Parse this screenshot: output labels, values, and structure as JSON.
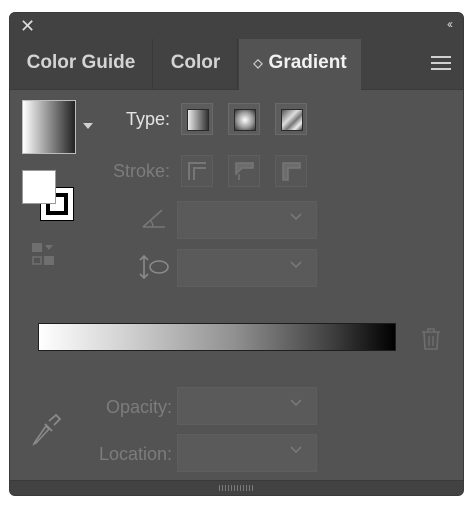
{
  "titlebar": {
    "close_icon": "close-icon",
    "collapse_icon": "double-chevron-left-icon",
    "close_glyph": "✕",
    "collapse_glyph": "‹‹"
  },
  "tabs": [
    {
      "label": "Color Guide",
      "active": false
    },
    {
      "label": "Color",
      "active": false
    },
    {
      "label": "Gradient",
      "active": true
    }
  ],
  "labels": {
    "type": "Type:",
    "stroke": "Stroke:",
    "opacity": "Opacity:",
    "location": "Location:"
  },
  "type_buttons": [
    "linear-gradient-icon",
    "radial-gradient-icon",
    "freeform-gradient-icon"
  ],
  "stroke_buttons": [
    "stroke-within-icon",
    "stroke-along-icon",
    "stroke-across-icon"
  ],
  "angle": {
    "value": "",
    "icon": "angle-icon"
  },
  "aspect_ratio": {
    "value": "",
    "icon": "aspect-ratio-icon"
  },
  "opacity": {
    "value": ""
  },
  "location": {
    "value": ""
  },
  "colors": {
    "panel_bg": "#535353",
    "tab_bar_bg": "#424242",
    "label_enabled": "#e4e4e4",
    "label_disabled": "#7c7c7c",
    "gradient_start": "#ffffff",
    "gradient_end": "#000000"
  }
}
